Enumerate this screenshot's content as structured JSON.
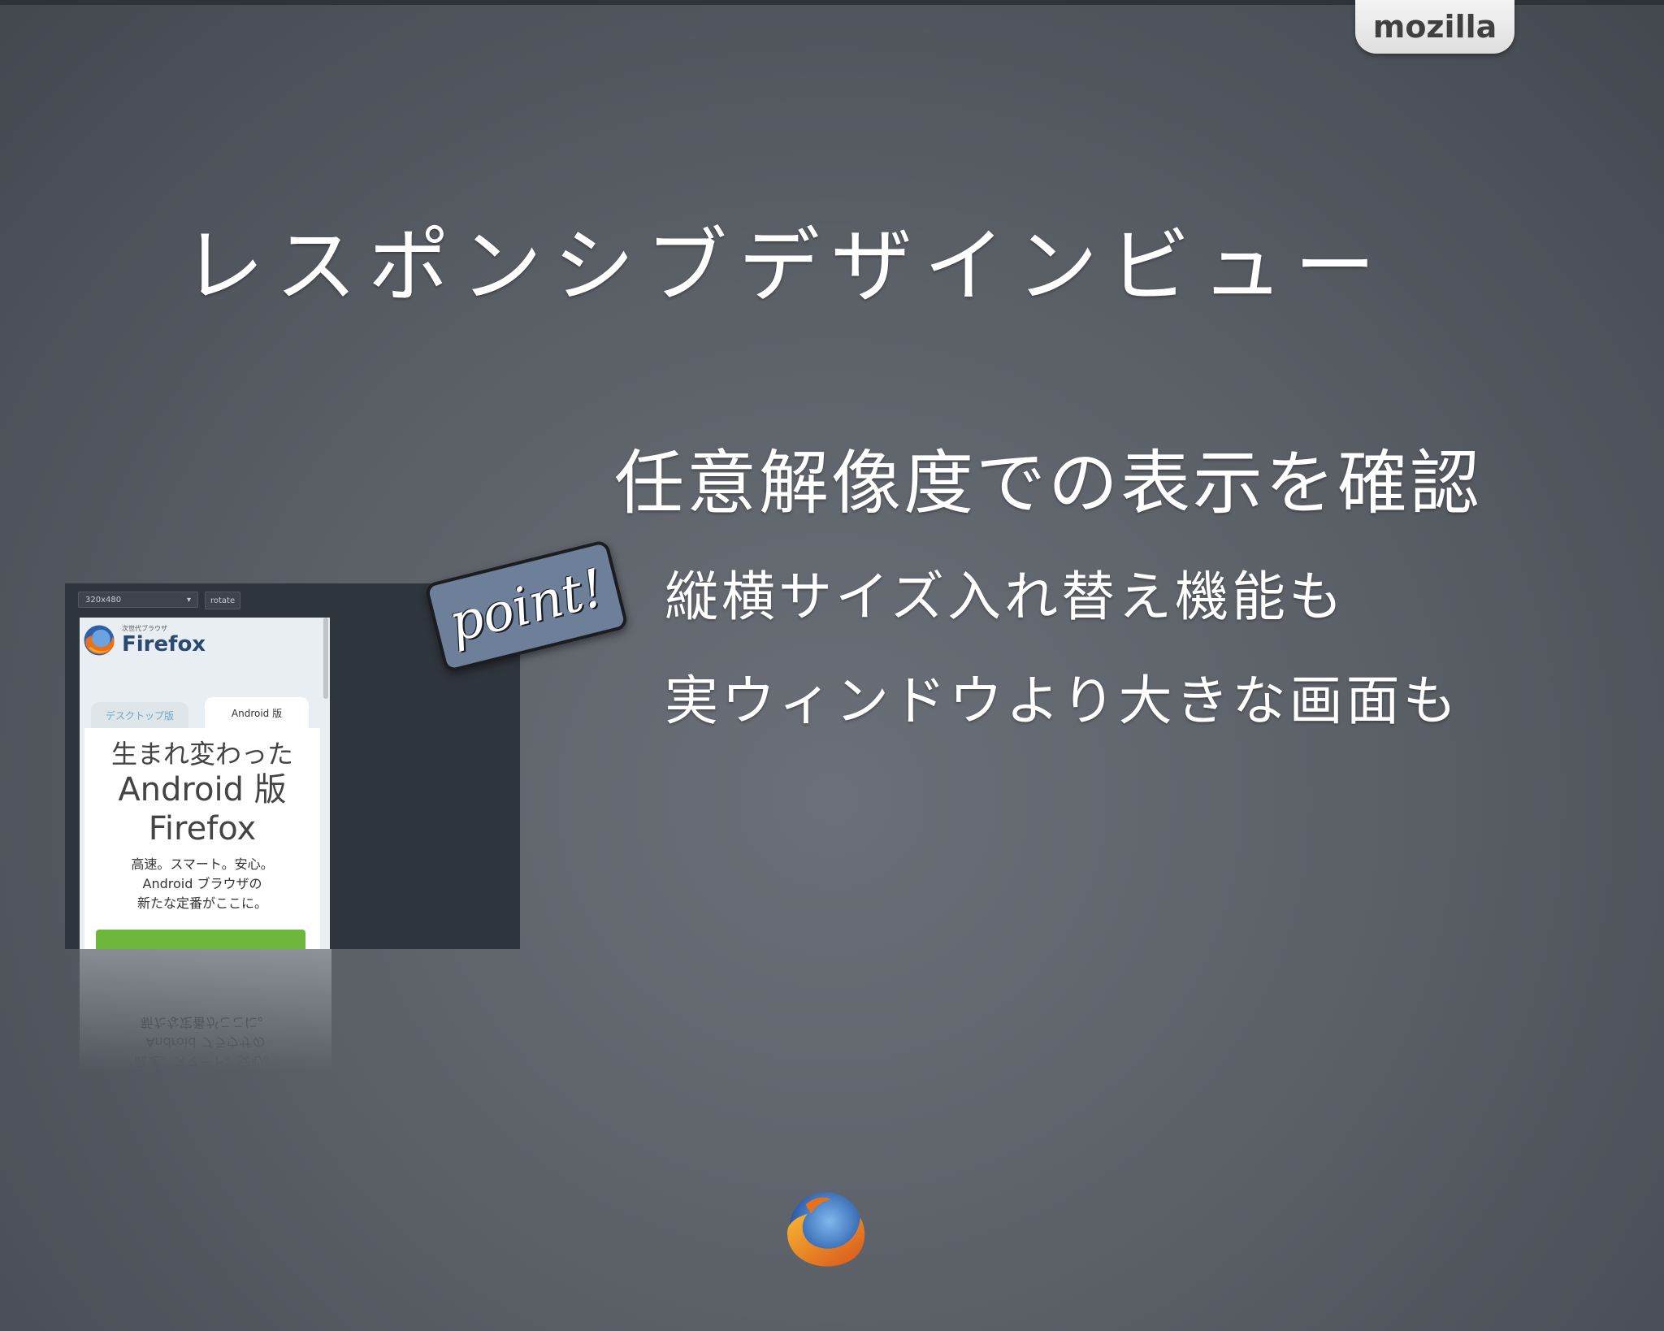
{
  "header": {
    "brand": "mozilla"
  },
  "slide": {
    "title": "レスポンシブデザインビュー",
    "bullets": [
      "任意解像度での表示を確認",
      "縦横サイズ入れ替え機能も",
      "実ウィンドウより大きな画面も"
    ]
  },
  "badge": {
    "label": "point!"
  },
  "screenshot": {
    "size_select": "320x480",
    "rotate_button": "rotate",
    "site_tagline": "次世代ブラウザ",
    "site_name": "Firefox",
    "tab_desktop": "デスクトップ版",
    "tab_android": "Android 版",
    "headline_1": "生まれ変わった",
    "headline_2": "Android 版",
    "headline_3": "Firefox",
    "body_1": "高速。スマート。安心。",
    "body_2": "Android ブラウザの",
    "body_3": "新たな定番がここに。"
  },
  "colors": {
    "background": "#5c6168",
    "tab_bg": "#eeeeee",
    "badge_bg": "#6e7f99",
    "accent_green": "#6fb63c"
  },
  "icons": [
    "firefox-logo-icon"
  ]
}
